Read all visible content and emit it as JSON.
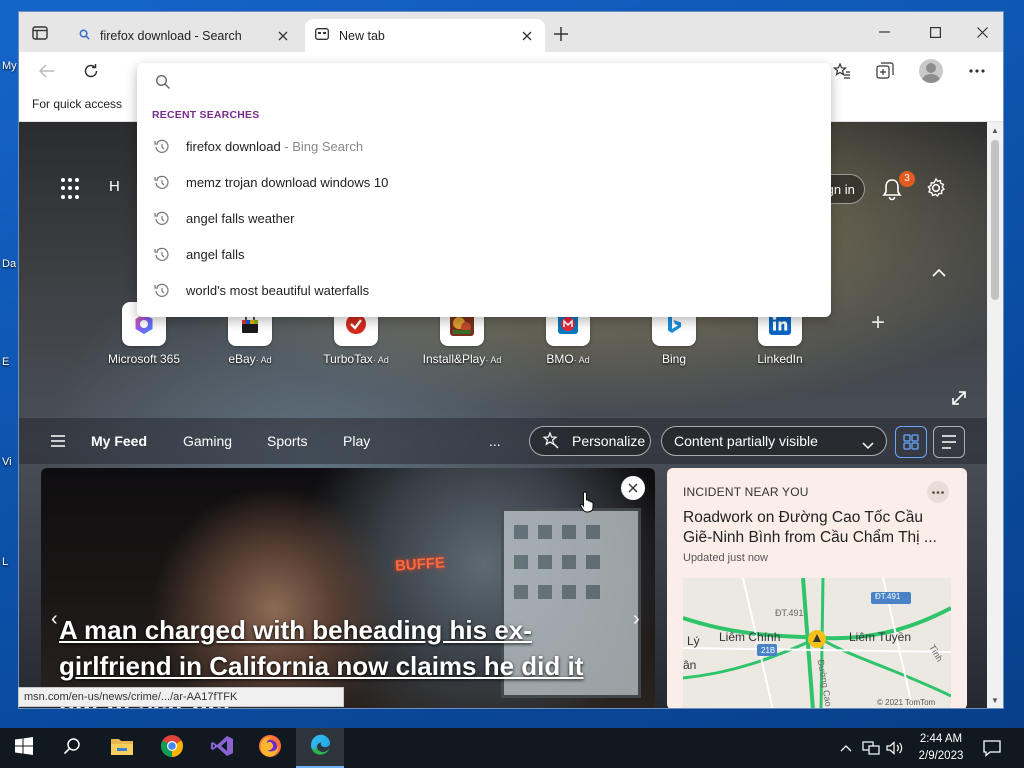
{
  "desktop": {
    "labels": [
      "My",
      "Da",
      "E",
      "Vi",
      "L"
    ]
  },
  "browser": {
    "tabs": [
      {
        "title": "firefox download - Search",
        "active": false
      },
      {
        "title": "New tab",
        "active": true
      }
    ],
    "favorites_bar_text": "For quick access"
  },
  "address_dropdown": {
    "input_value": "",
    "heading": "RECENT SEARCHES",
    "items": [
      {
        "text": "firefox download",
        "sub": " - Bing Search"
      },
      {
        "text": "memz trojan download windows 10",
        "sub": ""
      },
      {
        "text": "angel falls weather",
        "sub": ""
      },
      {
        "text": "angel falls",
        "sub": ""
      },
      {
        "text": "world's most beautiful waterfalls",
        "sub": ""
      }
    ]
  },
  "newtab": {
    "header_letter": "H",
    "signin_label": "Sign in",
    "notification_count": "3",
    "quick_links": [
      {
        "label": "Microsoft 365",
        "ad": "",
        "icon": "microsoft-365-icon"
      },
      {
        "label": "eBay",
        "ad": "· Ad",
        "icon": "ebay-icon"
      },
      {
        "label": "TurboTax",
        "ad": "· Ad",
        "icon": "turbotax-icon"
      },
      {
        "label": "Install&Play",
        "ad": "· Ad",
        "icon": "install-play-icon"
      },
      {
        "label": "BMO",
        "ad": "· Ad",
        "icon": "bmo-icon"
      },
      {
        "label": "Bing",
        "ad": "",
        "icon": "bing-icon"
      },
      {
        "label": "LinkedIn",
        "ad": "",
        "icon": "linkedin-icon"
      }
    ],
    "feed_tabs": [
      "My Feed",
      "Gaming",
      "Sports",
      "Play"
    ],
    "more_label": "...",
    "personalize_label": "Personalize",
    "content_visibility": "Content partially visible",
    "hero": {
      "headline": "A man charged with beheading his ex-girlfriend in California now claims he did it out of self-def",
      "sign_text": "BUFFE"
    },
    "incident": {
      "heading": "INCIDENT NEAR YOU",
      "title": "Roadwork on Đường Cao Tốc Cầu Giẽ-Ninh Bình from Cầu Chẩm Thị ...",
      "updated": "Updated just now",
      "map_labels": [
        "Lý",
        "Liêm Chính",
        "Liêm Tuyền",
        "ĐT.491",
        "ĐT.491",
        "21B",
        "ân",
        "Tình",
        "Đường Cao",
        "© 2021 TomTom"
      ]
    }
  },
  "statusbar": {
    "url": "msn.com/en-us/news/crime/.../ar-AA17fTFK"
  },
  "taskbar": {
    "time": "2:44 AM",
    "date": "2/9/2023",
    "apps": [
      "start-icon",
      "search-icon",
      "file-explorer-icon",
      "chrome-icon",
      "visual-studio-icon",
      "firefox-icon",
      "edge-icon"
    ]
  },
  "colors": {
    "accent": "#0b67d1",
    "recent_heading": "#7a2c8c",
    "badge": "#e55b1f",
    "taskbar": "#101820"
  }
}
